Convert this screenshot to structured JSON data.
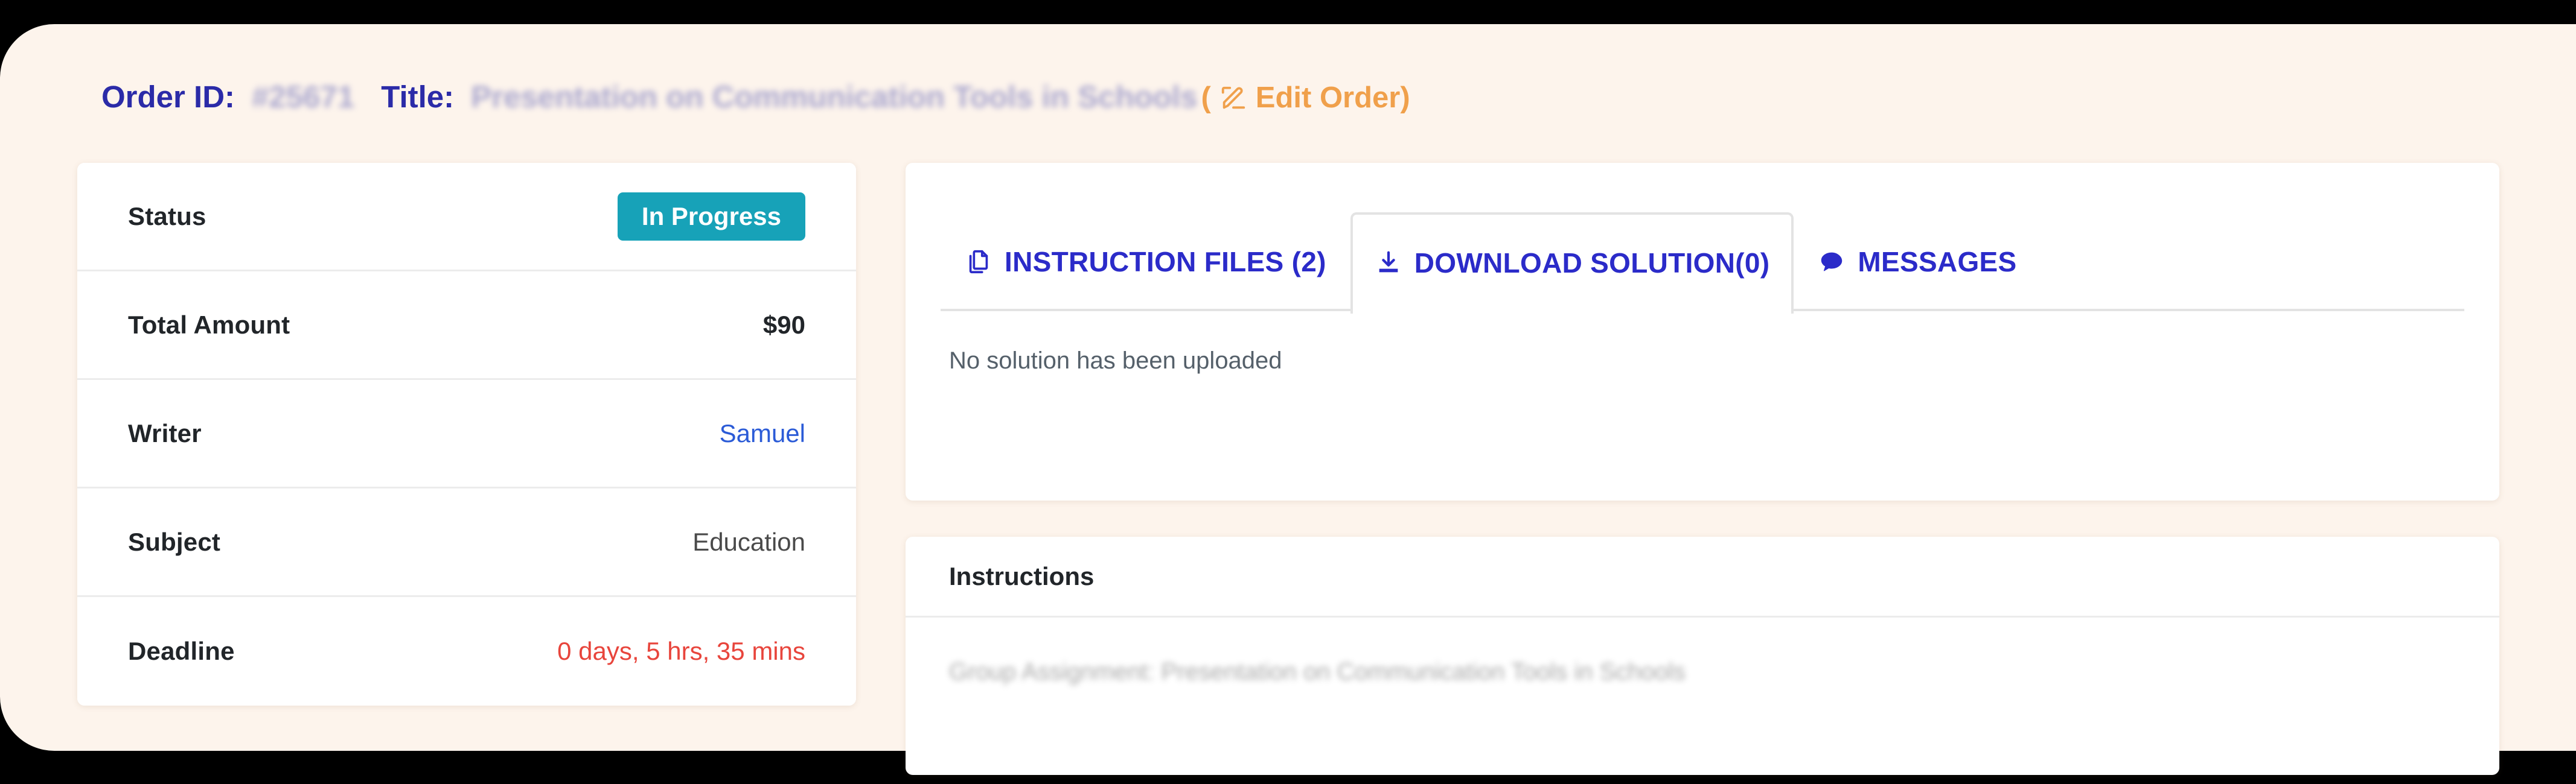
{
  "header": {
    "order_id_label": "Order ID:",
    "order_id_value": "#25671",
    "title_label": "Title:",
    "title_value": "Presentation on Communication Tools in Schools",
    "edit_order_label": "Edit Order)",
    "edit_order_prefix": "(",
    "edit_icon": "edit-pencil-square-icon",
    "label_color": "#2B2BA8",
    "accent_color": "#F0A04B"
  },
  "details": {
    "rows": [
      {
        "key": "Status",
        "value": "In Progress",
        "kind": "badge"
      },
      {
        "key": "Total Amount",
        "value": "$90",
        "kind": "bold"
      },
      {
        "key": "Writer",
        "value": "Samuel",
        "kind": "link"
      },
      {
        "key": "Subject",
        "value": "Education",
        "kind": "plain"
      },
      {
        "key": "Deadline",
        "value": "0 days, 5 hrs, 35 mins",
        "kind": "danger"
      }
    ],
    "status_badge_color": "#17A2B8",
    "link_color": "#2B5BD7",
    "danger_color": "#E8453C"
  },
  "tabs": {
    "items": [
      {
        "label": "INSTRUCTION FILES (2)",
        "icon": "files-copy-icon",
        "active": false
      },
      {
        "label": "DOWNLOAD SOLUTION(0)",
        "icon": "download-icon",
        "active": true
      },
      {
        "label": "MESSAGES",
        "icon": "chat-bubble-icon",
        "active": false
      }
    ],
    "active_index": 1,
    "tab_text_color": "#2B2BC9",
    "body_text": "No solution has been uploaded"
  },
  "instructions": {
    "header": "Instructions",
    "body": "Group Assignment: Presentation on Communication Tools in Schools"
  }
}
